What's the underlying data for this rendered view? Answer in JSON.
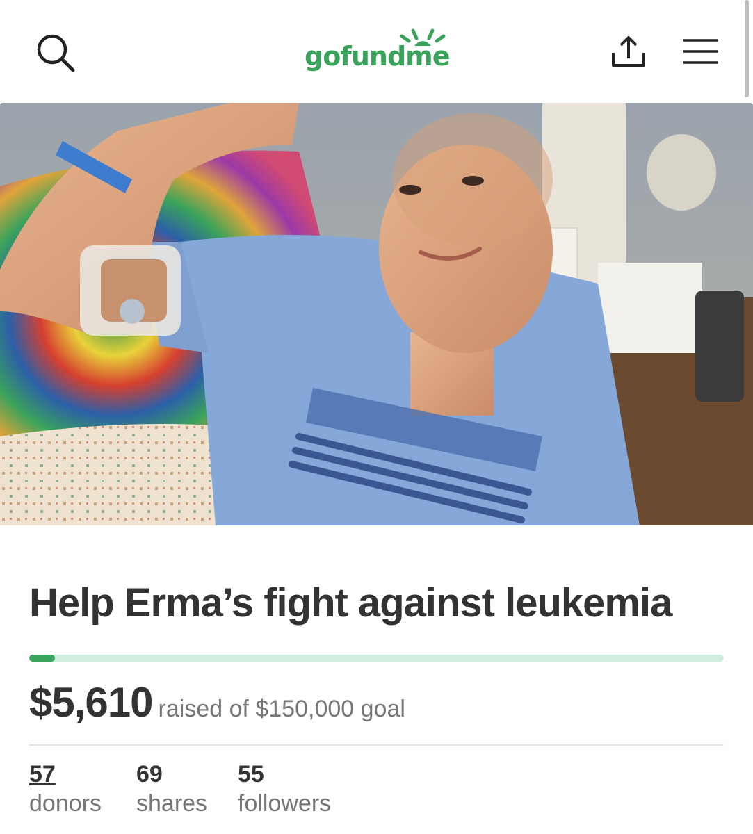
{
  "header": {
    "logo_text": "gofundme",
    "brand_color": "#3aa35b",
    "icons": {
      "search": "search-icon",
      "share": "share-icon",
      "menu": "hamburger-menu-icon"
    }
  },
  "campaign": {
    "title": "Help Erma’s fight against leukemia",
    "amount_raised": "$5,610",
    "goal_text": "raised of $150,000 goal",
    "progress_fraction": 0.0374,
    "progress_color": "#3aa35b",
    "progress_track_color": "#cfeede"
  },
  "stats": [
    {
      "value": "57",
      "label": "donors"
    },
    {
      "value": "69",
      "label": "shares"
    },
    {
      "value": "55",
      "label": "followers"
    }
  ]
}
